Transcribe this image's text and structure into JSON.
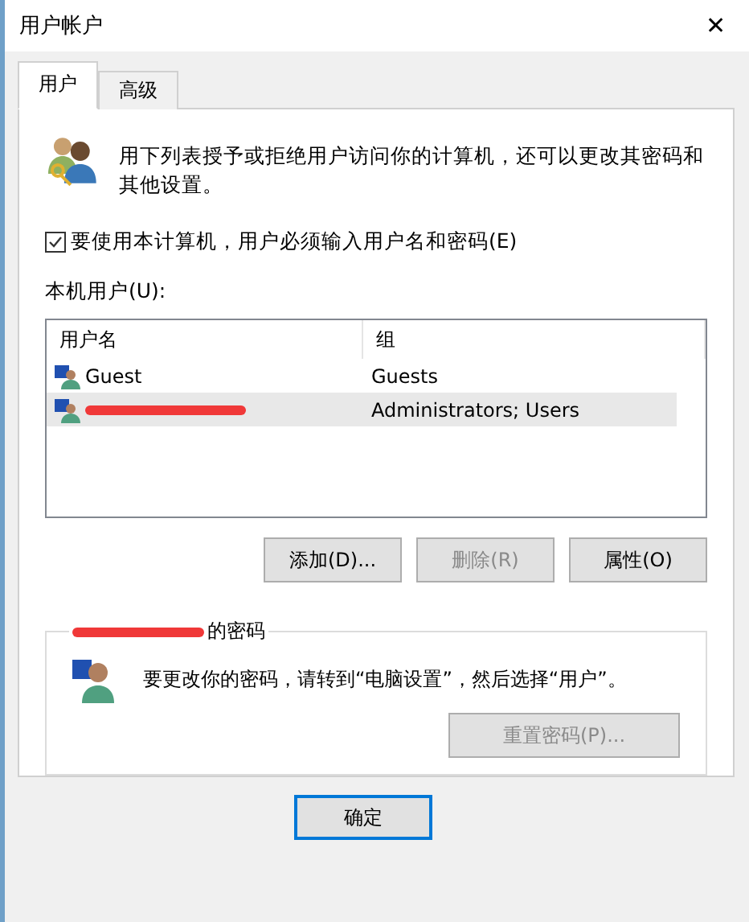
{
  "window": {
    "title": "用户帐户",
    "close": "✕"
  },
  "tabs": [
    {
      "label": "用户",
      "selected": true
    },
    {
      "label": "高级",
      "selected": false
    }
  ],
  "intro": {
    "text": "用下列表授予或拒绝用户访问你的计算机，还可以更改其密码和其他设置。"
  },
  "require_password": {
    "label": "要使用本计算机，用户必须输入用户名和密码(E)",
    "checked": true
  },
  "users_label": "本机用户(U):",
  "table": {
    "columns": [
      "用户名",
      "组"
    ],
    "rows": [
      {
        "name": "Guest",
        "group": "Guests",
        "selected": false,
        "redacted": false
      },
      {
        "group": "Administrators; Users",
        "selected": true,
        "redacted": true
      }
    ]
  },
  "table_buttons": [
    {
      "label": "添加(D)...",
      "disabled": false
    },
    {
      "label": "删除(R)",
      "disabled": true
    },
    {
      "label": "属性(O)",
      "disabled": false
    }
  ],
  "password_group": {
    "title": "的密码",
    "redacted": true,
    "text": "要更改你的密码，请转到“电脑设置”，然后选择“用户”。",
    "button": {
      "label": "重置密码(P)...",
      "disabled": true
    }
  },
  "dialog_buttons": [
    {
      "label": "确定",
      "default": true
    }
  ]
}
